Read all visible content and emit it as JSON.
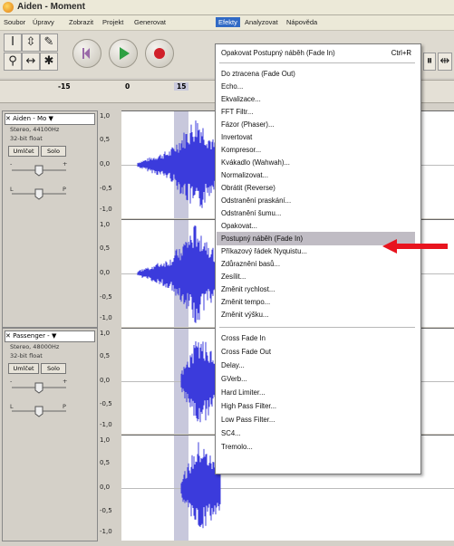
{
  "window": {
    "title": "Aiden - Moment"
  },
  "menubar": [
    "Soubor",
    "Úpravy",
    "Zobrazit",
    "Projekt",
    "Generovat",
    "Efekty",
    "Analyzovat",
    "Nápověda"
  ],
  "ruler": {
    "ticks": [
      "-15",
      "0",
      "15"
    ]
  },
  "tracks": [
    {
      "name": "Aiden - Mo",
      "rate": "Stereo, 44100Hz",
      "format": "32-bit float",
      "mute": "Umlčet",
      "solo": "Solo",
      "gain_left": "-",
      "gain_right": "+",
      "pan_left": "L",
      "pan_right": "P",
      "scale": [
        "1,0",
        "0,5",
        "0,0",
        "-0,5",
        "-1,0"
      ]
    },
    {
      "name": "",
      "scale": [
        "1,0",
        "0,5",
        "0,0",
        "-0,5",
        "-1,0"
      ]
    },
    {
      "name": "Passenger -",
      "rate": "Stereo, 48000Hz",
      "format": "32-bit float",
      "mute": "Umlčet",
      "solo": "Solo",
      "gain_left": "-",
      "gain_right": "+",
      "pan_left": "L",
      "pan_right": "P",
      "scale": [
        "1,0",
        "0,5",
        "0,0",
        "-0,5",
        "-1,0"
      ]
    },
    {
      "name": "",
      "scale": [
        "1,0",
        "0,5",
        "0,0",
        "-0,5",
        "-1,0"
      ]
    }
  ],
  "effects_menu": {
    "repeat": {
      "label": "Opakovat Postupný náběh (Fade In)",
      "shortcut": "Ctrl+R"
    },
    "group1": [
      "Do ztracena (Fade Out)",
      "Echo...",
      "Ekvalizace...",
      "FFT Filtr...",
      "Fázor (Phaser)...",
      "Invertovat",
      "Kompresor...",
      "Kvákadlo (Wahwah)...",
      "Normalizovat...",
      "Obrátit (Reverse)",
      "Odstranění praskání...",
      "Odstranění šumu...",
      "Opakovat...",
      "Postupný náběh (Fade In)",
      "Příkazový řádek Nyquistu...",
      "Zdůraznění basů...",
      "Zesílit...",
      "Změnit rychlost...",
      "Změnit tempo...",
      "Změnit výšku..."
    ],
    "group2": [
      "Cross Fade In",
      "Cross Fade Out",
      "Delay...",
      "GVerb...",
      "Hard Limiter...",
      "High Pass Filter...",
      "Low Pass Filter...",
      "SC4...",
      "Tremolo..."
    ],
    "highlighted": "Postupný náběh (Fade In)"
  },
  "colors": {
    "waveform": "#3b3bdc",
    "highlight": "#c0bcc4",
    "menu_active": "#316ac5",
    "arrow": "#e8141e"
  }
}
